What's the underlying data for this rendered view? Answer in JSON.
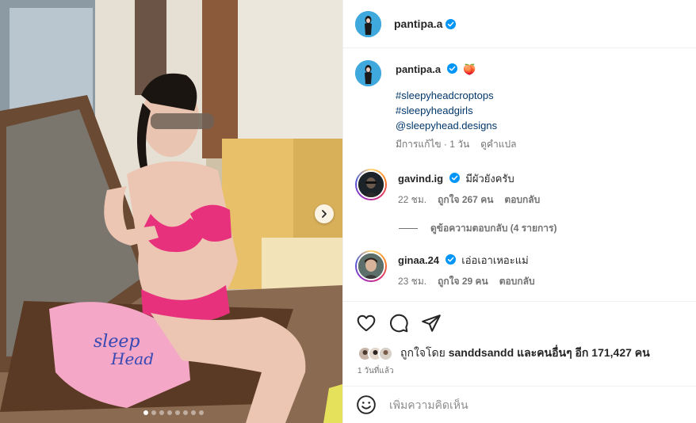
{
  "post": {
    "username": "pantipa.a",
    "verified": true,
    "carousel": {
      "slides": 8,
      "active_index": 0
    }
  },
  "caption": {
    "username": "pantipa.a",
    "emoji": "🍑",
    "lines": [
      "#sleepyheadcroptops",
      "#sleepyheadgirls",
      "@sleepyhead.designs"
    ],
    "edited": "มีการแก้ไข · 1 วัน",
    "translate_label": "ดูคำแปล"
  },
  "comments": [
    {
      "username": "gavind.ig",
      "text": "มีผัวยังครับ",
      "age": "22 ชม.",
      "likes": "ถูกใจ 267 คน",
      "reply_label": "ตอบกลับ"
    },
    {
      "username": "ginaa.24",
      "text": "เอ่อเอาเหอะแม่",
      "age": "23 ชม.",
      "likes": "ถูกใจ 29 คน",
      "reply_label": "ตอบกลับ"
    }
  ],
  "view_replies": "ดูข้อความตอบกลับ (4 รายการ)",
  "likes_summary": {
    "prefix": "ถูกใจโดย",
    "user": "sanddsandd",
    "suffix": "และคนอื่นๆ อีก 171,427 คน"
  },
  "posted_time": "1 วันที่แล้ว",
  "composer": {
    "placeholder": "เพิ่มความคิดเห็น"
  },
  "colors": {
    "link": "#00376b",
    "verified": "#0095f6",
    "muted": "#737373",
    "avatar_bg": "#3fa8dc"
  },
  "icons": [
    "heart-icon",
    "comment-icon",
    "share-icon",
    "chevron-right-icon",
    "emoji-icon",
    "verified-badge-icon"
  ]
}
